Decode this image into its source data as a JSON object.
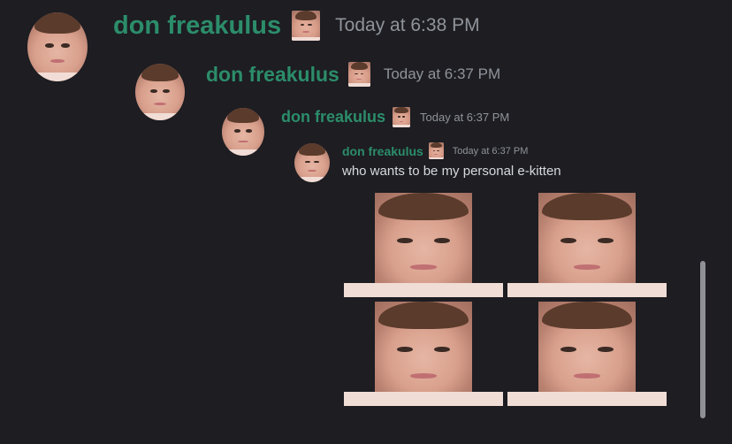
{
  "messages": [
    {
      "username": "don freakulus",
      "timestamp": "Today at 6:38 PM"
    },
    {
      "username": "don freakulus",
      "timestamp": "Today at 6:37 PM"
    },
    {
      "username": "don freakulus",
      "timestamp": "Today at 6:37 PM"
    },
    {
      "username": "don freakulus",
      "timestamp": "Today at 6:37 PM",
      "text": "who wants to be my personal e-kitten"
    }
  ],
  "icons": {
    "avatar": "profile-face-icon",
    "badge": "face-emoji-icon",
    "attachment": "face-image-icon"
  },
  "colors": {
    "background": "#1d1d22",
    "username": "#2c8d6a",
    "timestamp": "#8f949a",
    "message_text": "#d7d9dd"
  }
}
